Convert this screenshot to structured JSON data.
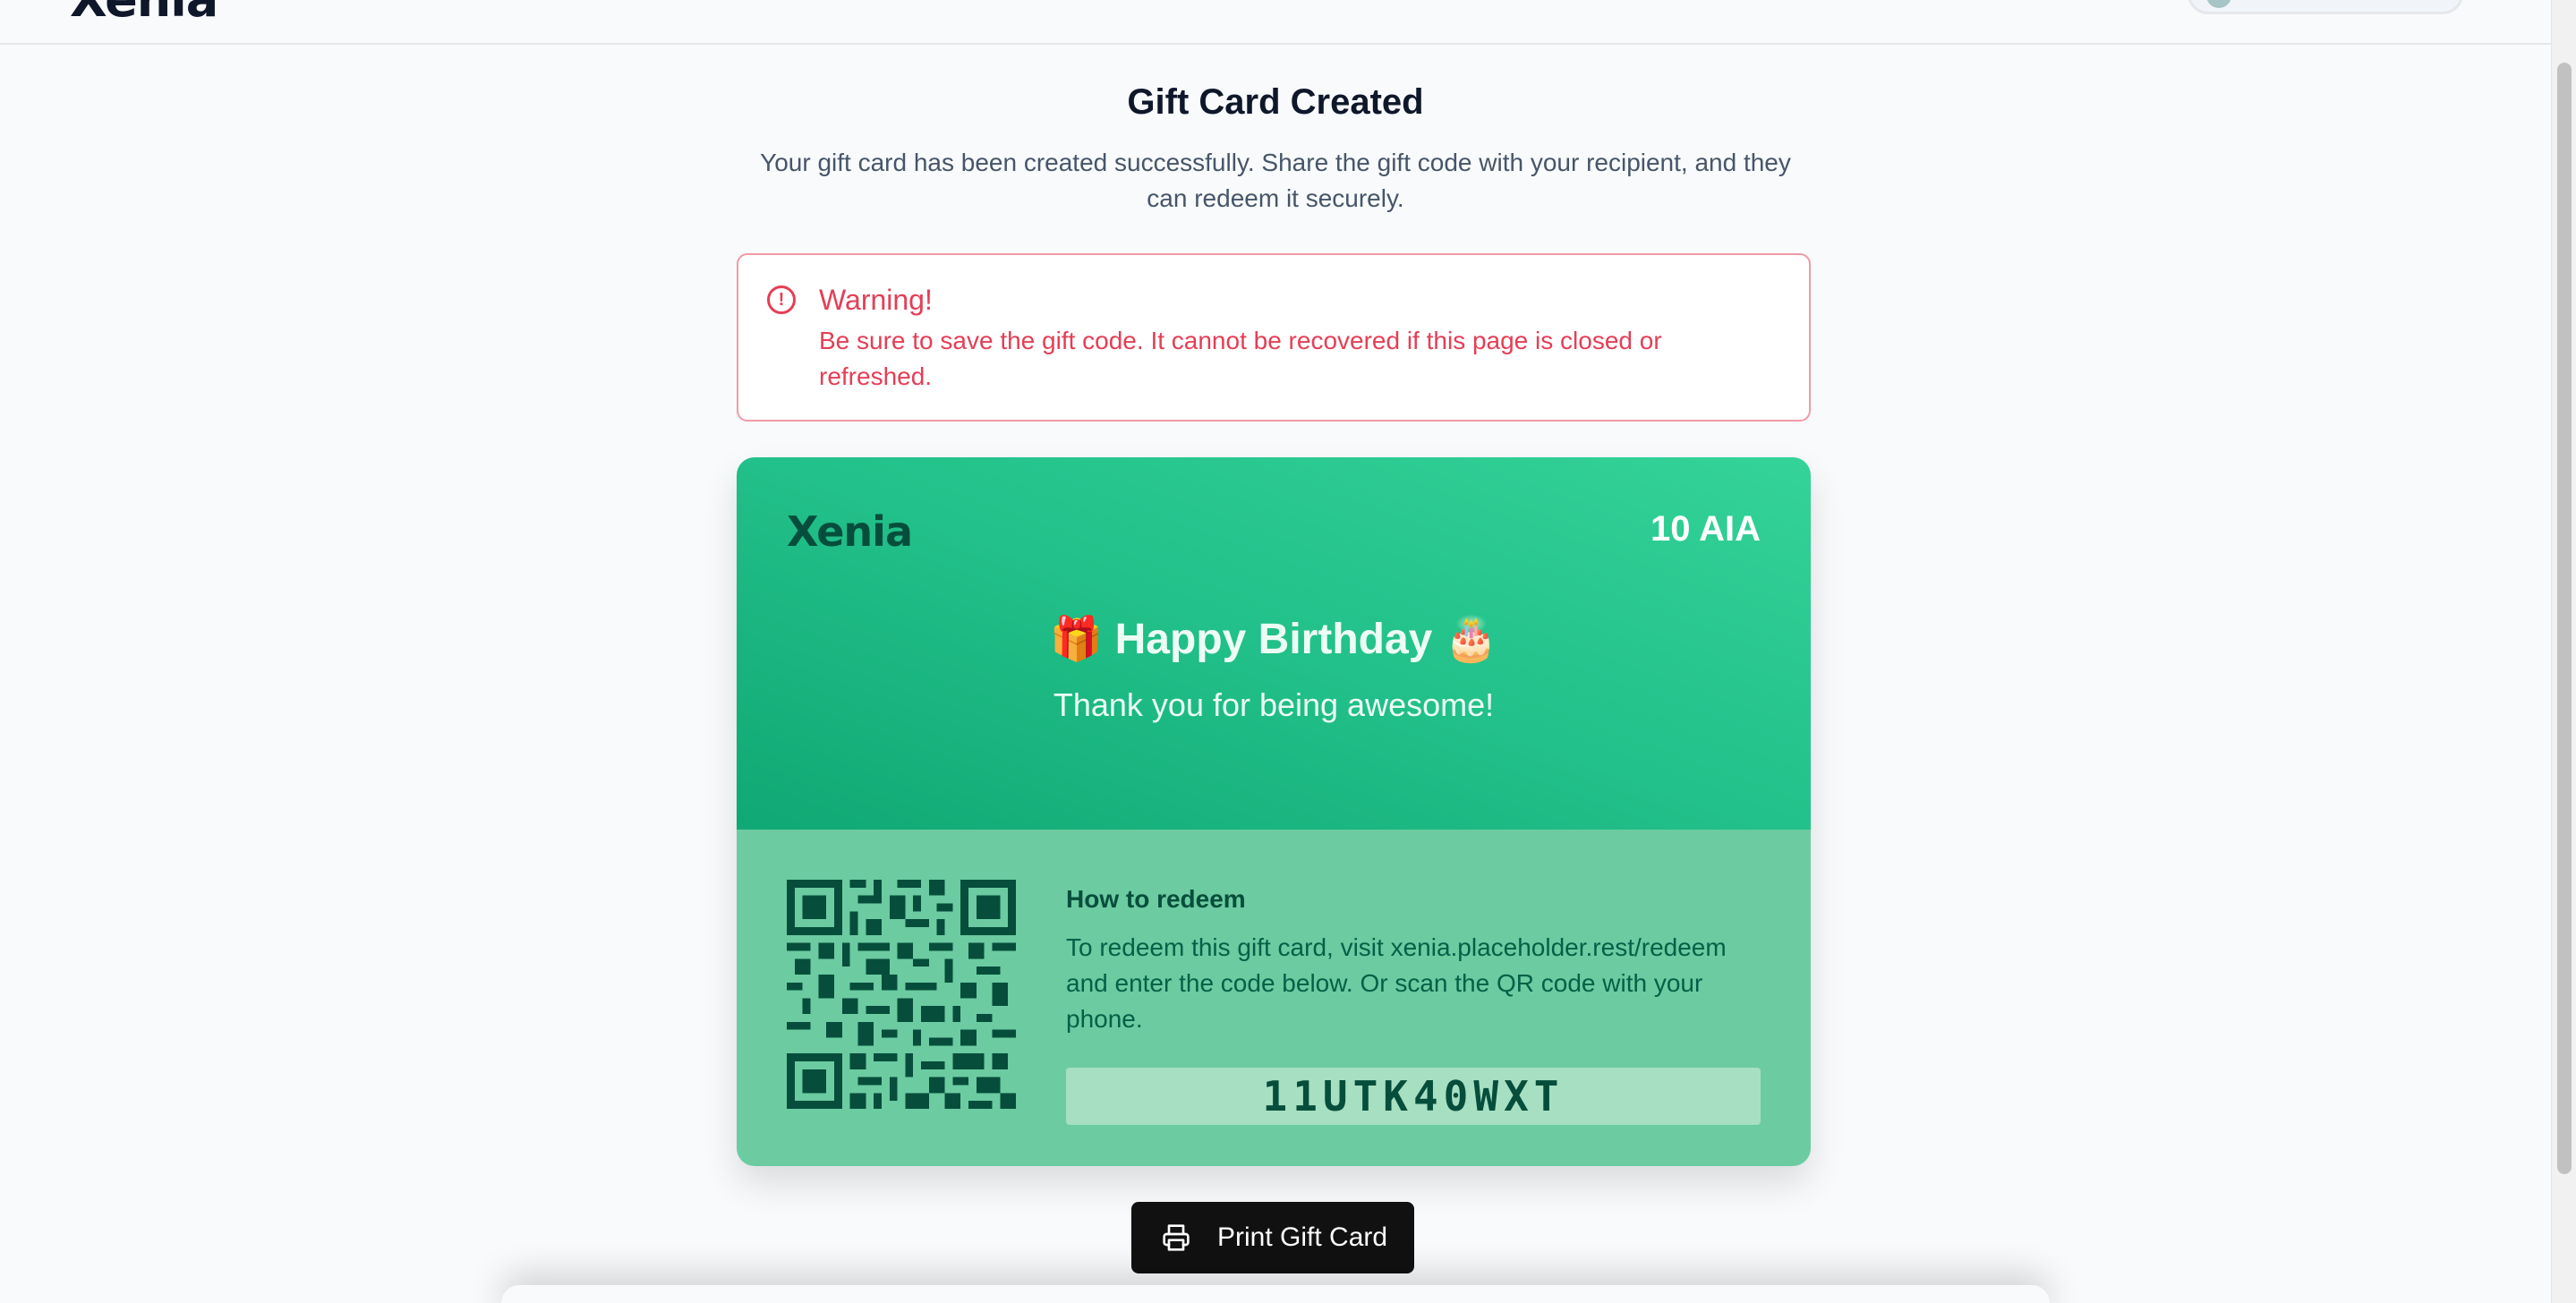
{
  "header": {
    "logo": "Xenia"
  },
  "page": {
    "title": "Gift Card Created",
    "description": "Your gift card has been created successfully. Share the gift code with your recipient, and they can redeem it securely."
  },
  "warning": {
    "icon": "alert-circle-icon",
    "title": "Warning!",
    "body": "Be sure to save the gift code. It cannot be recovered if this page is closed or refreshed."
  },
  "gift_card": {
    "brand": "Xenia",
    "amount": "10 AIA",
    "headline": "🎁 Happy Birthday 🎂",
    "tagline": "Thank you for being awesome!",
    "redeem_title": "How to redeem",
    "redeem_body": "To redeem this gift card, visit xenia.placeholder.rest/redeem and enter the code below. Or scan the QR code with your phone.",
    "code": "11UTK40WXT",
    "qr_icon": "qr-code"
  },
  "actions": {
    "print_label": "Print Gift Card",
    "print_icon": "printer-icon"
  },
  "colors": {
    "card_gradient_start": "#34d399",
    "card_gradient_end": "#10a874",
    "card_bottom": "#6ccba1",
    "warning": "#e53e55",
    "button": "#111111"
  }
}
